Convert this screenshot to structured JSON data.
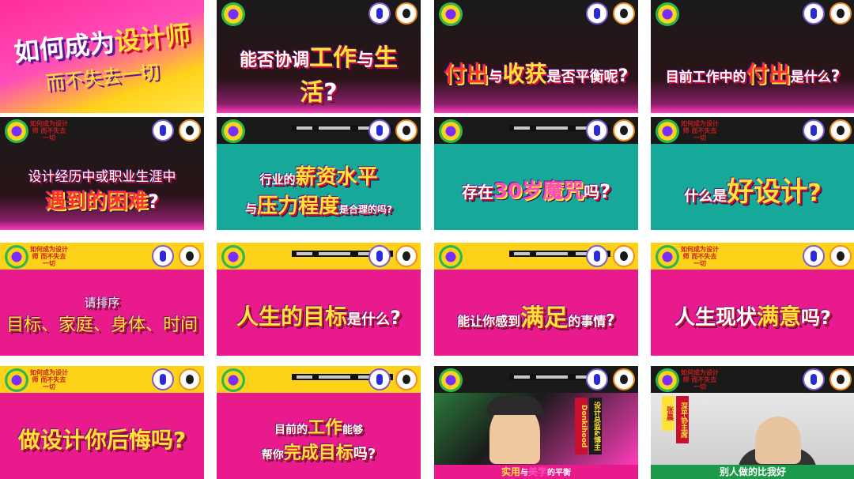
{
  "header": {
    "mini_title": "如何成为设计师 而不失去一切"
  },
  "hero": {
    "line1_a": "如何成为",
    "line1_b": "设计师",
    "line2": "而不失去一切"
  },
  "tiles": [
    {
      "t1": "能否协调",
      "t2": "工作",
      "t3": "与",
      "t4": "生活",
      "t5": "?"
    },
    {
      "t1": "付出",
      "t2": "与",
      "t3": "收获",
      "t4": "是否平衡呢",
      "t5": "?"
    },
    {
      "t1": "目前工作中的",
      "t2": "付出",
      "t3": "是什么",
      "t4": "?"
    },
    {
      "t1": "设计经历中或职业生涯中",
      "t2": "遇到的困难",
      "t3": "?"
    },
    {
      "t1": "行业的",
      "t2": "薪资水平",
      "t3": "与",
      "t4": "压力程度",
      "t5": "是合理的吗?"
    },
    {
      "t1": "存在",
      "t2": "30岁魔咒",
      "t3": "吗",
      "t4": "?"
    },
    {
      "t1": "什么是",
      "t2": "好设计",
      "t3": "?"
    },
    {
      "t1": "请排序",
      "t2": "目标、家庭、身体、时间"
    },
    {
      "t1": "人生的",
      "t2": "目标",
      "t3": "是什么",
      "t4": "?"
    },
    {
      "t1": "能让你感到",
      "t2": "满足",
      "t3": "的事情",
      "t4": "?"
    },
    {
      "t1": "人生现状",
      "t2": "满意",
      "t3": "吗",
      "t4": "?"
    },
    {
      "t1": "做设计你后悔吗",
      "t2": "?"
    },
    {
      "t1": "目前的",
      "t2": "工作",
      "t3": "能够",
      "t4": "帮你",
      "t5": "完成目标",
      "t6": "吗?"
    },
    {
      "v1": "Donkihood",
      "v2": "设计总监&博主",
      "c1": "实用",
      "c2": "与",
      "c3": "美学",
      "c4": "的平衡"
    },
    {
      "v1": "张晨",
      "v2": "深平协主席",
      "c1": "别人做的比我好"
    }
  ]
}
